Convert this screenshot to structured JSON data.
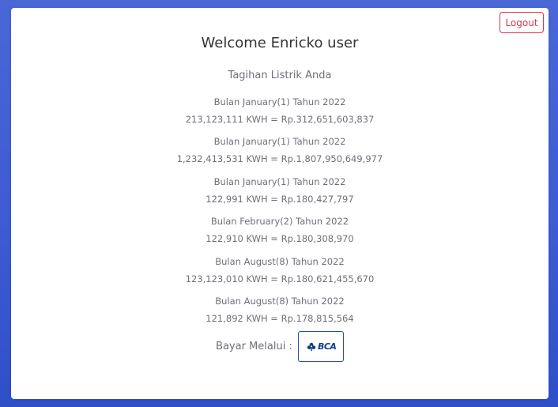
{
  "header": {
    "logout_label": "Logout",
    "welcome": "Welcome Enricko user"
  },
  "main": {
    "subtitle": "Tagihan Listrik Anda",
    "bills": [
      {
        "month": "Bulan January(1) Tahun 2022",
        "amount": "213,123,111 KWH = Rp.312,651,603,837"
      },
      {
        "month": "Bulan January(1) Tahun 2022",
        "amount": "1,232,413,531 KWH = Rp.1,807,950,649,977"
      },
      {
        "month": "Bulan January(1) Tahun 2022",
        "amount": "122,991 KWH = Rp.180,427,797"
      },
      {
        "month": "Bulan February(2) Tahun 2022",
        "amount": "122,910 KWH = Rp.180,308,970"
      },
      {
        "month": "Bulan August(8) Tahun 2022",
        "amount": "123,123,010 KWH = Rp.180,621,455,670"
      },
      {
        "month": "Bulan August(8) Tahun 2022",
        "amount": "121,892 KWH = Rp.178,815,564"
      }
    ],
    "pay_label": "Bayar Melalui :",
    "pay_method": {
      "logo_text": "BCA",
      "icon": "bca-logo-icon"
    }
  },
  "colors": {
    "background_top": "#4a67d6",
    "background_bottom": "#2f4fc9",
    "logout": "#dc3545",
    "bca_blue": "#0a3d91"
  }
}
